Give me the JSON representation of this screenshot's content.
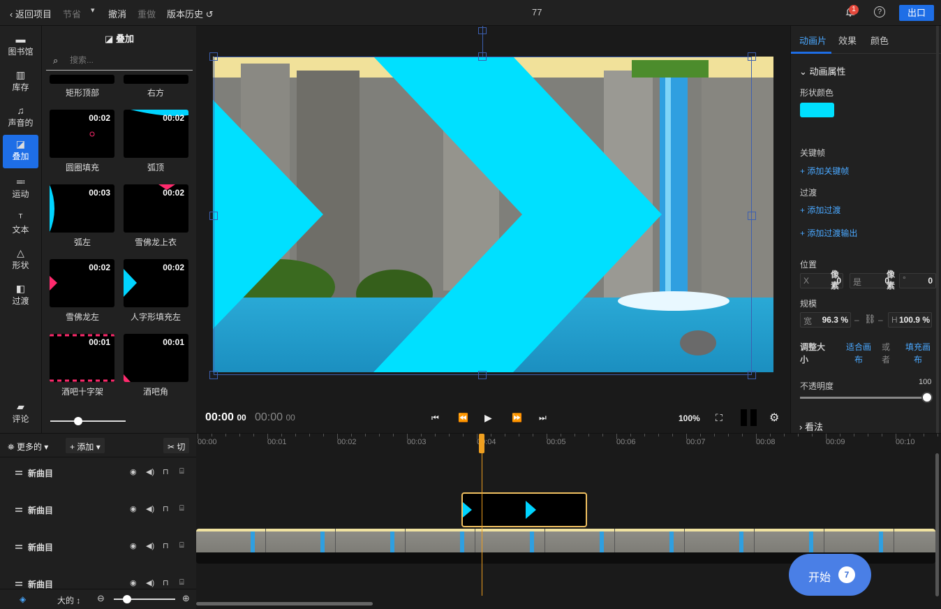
{
  "topbar": {
    "back_label": "返回项目",
    "section_label": "节省",
    "undo_label": "撤消",
    "redo_label": "重做",
    "history_label": "版本历史",
    "project_title": "77",
    "notification_count": "1",
    "export_label": "出口",
    "accent": "#1e6ee6"
  },
  "nav": {
    "items": [
      {
        "label": "图书馆",
        "icon": "folder-icon"
      },
      {
        "label": "库存",
        "icon": "library-icon"
      },
      {
        "label": "声音的",
        "icon": "music-icon"
      },
      {
        "label": "叠加",
        "icon": "overlay-icon"
      },
      {
        "label": "运动",
        "icon": "motion-icon"
      },
      {
        "label": "文本",
        "icon": "text-icon"
      },
      {
        "label": "形状",
        "icon": "shape-icon"
      },
      {
        "label": "过渡",
        "icon": "transition-icon"
      }
    ],
    "comments_label": "评论"
  },
  "panel": {
    "title": "叠加",
    "search_placeholder": "搜索...",
    "partial_labels": [
      "矩形顶部",
      "右方"
    ],
    "tiles": [
      {
        "label": "圆圈填充",
        "duration": "00:02"
      },
      {
        "label": "弧顶",
        "duration": "00:02"
      },
      {
        "label": "弧左",
        "duration": "00:03"
      },
      {
        "label": "雪佛龙上衣",
        "duration": "00:02"
      },
      {
        "label": "雪佛龙左",
        "duration": "00:02"
      },
      {
        "label": "人字形填充左",
        "duration": "00:02"
      },
      {
        "label": "酒吧十字架",
        "duration": "00:01"
      },
      {
        "label": "酒吧角",
        "duration": "00:01"
      }
    ]
  },
  "player": {
    "current_time": "00:00",
    "current_frames": "00",
    "total_time": "00:00",
    "total_frames": "00",
    "zoom": "100%"
  },
  "right_panel": {
    "tabs": [
      "动画片",
      "效果",
      "颜色"
    ],
    "section_title": "动画属性",
    "shape_color_label": "形状颜色",
    "shape_color": "#00e0ff",
    "keyframe_label": "关键帧",
    "add_keyframe": "添加关键帧",
    "transition_label": "过渡",
    "add_transition": "添加过渡",
    "add_transition_out": "添加过渡输出",
    "position_label": "位置",
    "x_prefix": "X",
    "x_value": "0",
    "x_unit": "像素",
    "y_prefix": "是",
    "y_value": "0",
    "y_unit": "像素",
    "rot_prefix": "°",
    "rot_value": "0",
    "scale_label": "规模",
    "w_prefix": "宽",
    "w_value": "96.3",
    "w_unit": "%",
    "h_prefix": "H",
    "h_value": "100.9",
    "h_unit": "%",
    "resize_label": "调整大小",
    "fit_canvas": "适合画布",
    "or_label": "或者",
    "fill_canvas": "填充画布",
    "opacity_label": "不透明度",
    "opacity_value": "100",
    "opacity_level": 1.0,
    "look_label": "看法"
  },
  "timeline": {
    "more_label": "更多的",
    "add_label": "添加",
    "cut_label": "切",
    "ticks": [
      "00:00",
      "00:01",
      "00:02",
      "00:03",
      "00:04",
      "00:05",
      "00:06",
      "00:07",
      "00:08",
      "00:09",
      "00:10"
    ],
    "tracks": [
      {
        "name": "新曲目"
      },
      {
        "name": "新曲目"
      },
      {
        "name": "新曲目"
      },
      {
        "name": "新曲目"
      }
    ],
    "size_label": "大的",
    "start_label": "开始",
    "start_count": "7",
    "playhead_color": "#f0a020"
  }
}
